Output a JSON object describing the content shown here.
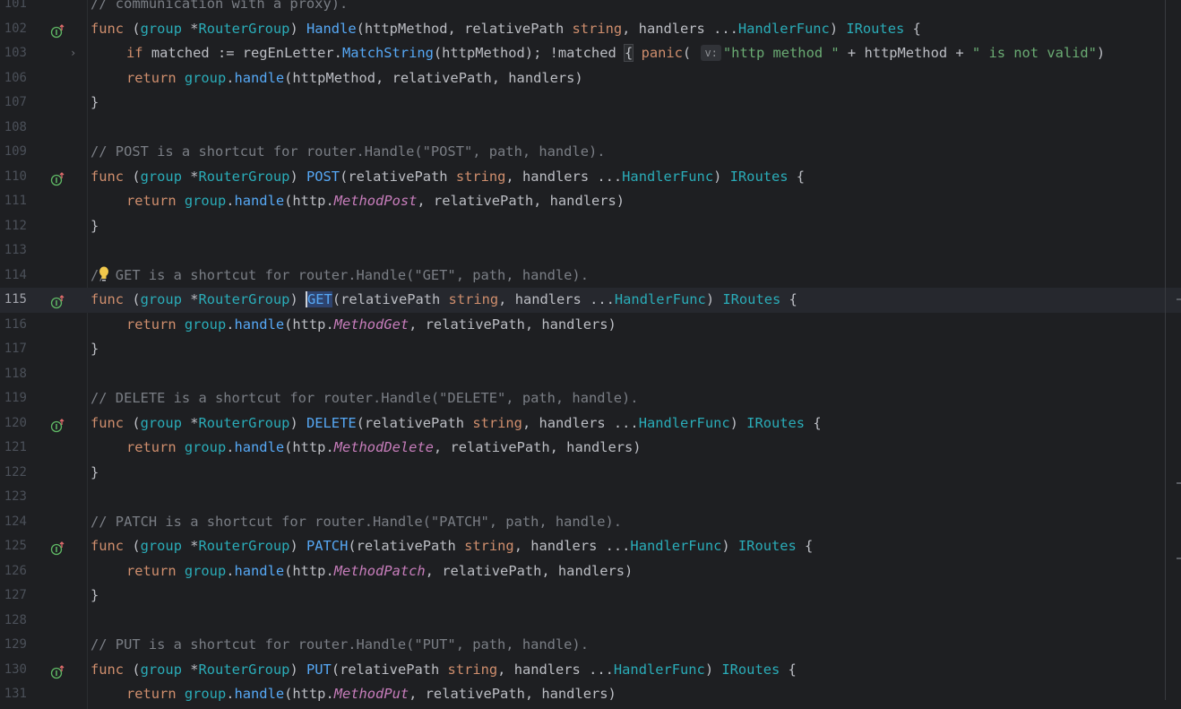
{
  "editor": {
    "lines": [
      {
        "num": "101",
        "top_cut": true,
        "tokens": [
          {
            "c": "c",
            "t": "// communication with a proxy)."
          }
        ]
      },
      {
        "num": "102",
        "impl": true,
        "tokens": [
          {
            "c": "k",
            "t": "func "
          },
          {
            "c": "r",
            "t": "("
          },
          {
            "c": "t",
            "t": "group"
          },
          {
            "c": "r",
            "t": " *"
          },
          {
            "c": "t",
            "t": "RouterGroup"
          },
          {
            "c": "r",
            "t": ") "
          },
          {
            "c": "f",
            "t": "Handle"
          },
          {
            "c": "r",
            "t": "(httpMethod, relativePath "
          },
          {
            "c": "k",
            "t": "string"
          },
          {
            "c": "r",
            "t": ", handlers ..."
          },
          {
            "c": "t",
            "t": "HandlerFunc"
          },
          {
            "c": "r",
            "t": ") "
          },
          {
            "c": "t",
            "t": "IRoutes"
          },
          {
            "c": "r",
            "t": " {"
          }
        ]
      },
      {
        "num": "103",
        "fold": true,
        "indent": true,
        "tokens": [
          {
            "c": "k",
            "t": "if "
          },
          {
            "c": "r",
            "t": "matched := regEnLetter."
          },
          {
            "c": "f",
            "t": "MatchString"
          },
          {
            "c": "r",
            "t": "(httpMethod); !matched "
          },
          {
            "c": "box",
            "t": "{"
          },
          {
            "c": "r",
            "t": " "
          },
          {
            "c": "k",
            "t": "panic"
          },
          {
            "c": "r",
            "t": "( "
          },
          {
            "c": "hint",
            "t": "v:"
          },
          {
            "c": "str",
            "t": "\"http method \""
          },
          {
            "c": "r",
            "t": " + httpMethod + "
          },
          {
            "c": "str",
            "t": "\" is not valid\""
          },
          {
            "c": "r",
            "t": ")"
          }
        ]
      },
      {
        "num": "106",
        "indent": true,
        "tokens": [
          {
            "c": "k",
            "t": "return "
          },
          {
            "c": "t",
            "t": "group"
          },
          {
            "c": "r",
            "t": "."
          },
          {
            "c": "f",
            "t": "handle"
          },
          {
            "c": "r",
            "t": "(httpMethod, relativePath, handlers)"
          }
        ]
      },
      {
        "num": "107",
        "tokens": [
          {
            "c": "r",
            "t": "}"
          }
        ]
      },
      {
        "num": "108",
        "tokens": []
      },
      {
        "num": "109",
        "tokens": [
          {
            "c": "c",
            "t": "// POST is a shortcut for router.Handle(\"POST\", path, handle)."
          }
        ]
      },
      {
        "num": "110",
        "impl": true,
        "tokens": [
          {
            "c": "k",
            "t": "func "
          },
          {
            "c": "r",
            "t": "("
          },
          {
            "c": "t",
            "t": "group"
          },
          {
            "c": "r",
            "t": " *"
          },
          {
            "c": "t",
            "t": "RouterGroup"
          },
          {
            "c": "r",
            "t": ") "
          },
          {
            "c": "f",
            "t": "POST"
          },
          {
            "c": "r",
            "t": "(relativePath "
          },
          {
            "c": "k",
            "t": "string"
          },
          {
            "c": "r",
            "t": ", handlers ..."
          },
          {
            "c": "t",
            "t": "HandlerFunc"
          },
          {
            "c": "r",
            "t": ") "
          },
          {
            "c": "t",
            "t": "IRoutes"
          },
          {
            "c": "r",
            "t": " {"
          }
        ]
      },
      {
        "num": "111",
        "indent": true,
        "tokens": [
          {
            "c": "k",
            "t": "return "
          },
          {
            "c": "t",
            "t": "group"
          },
          {
            "c": "r",
            "t": "."
          },
          {
            "c": "f",
            "t": "handle"
          },
          {
            "c": "r",
            "t": "(http."
          },
          {
            "c": "m",
            "t": "MethodPost"
          },
          {
            "c": "r",
            "t": ", relativePath, handlers)"
          }
        ]
      },
      {
        "num": "112",
        "tokens": [
          {
            "c": "r",
            "t": "}"
          }
        ]
      },
      {
        "num": "113",
        "tokens": []
      },
      {
        "num": "114",
        "bulb": true,
        "tokens": [
          {
            "c": "c",
            "t": "// GET is a shortcut for router.Handle(\"GET\", path, handle)."
          }
        ]
      },
      {
        "num": "115",
        "impl": true,
        "current": true,
        "tokens": [
          {
            "c": "k",
            "t": "func "
          },
          {
            "c": "r",
            "t": "("
          },
          {
            "c": "t",
            "t": "group"
          },
          {
            "c": "r",
            "t": " *"
          },
          {
            "c": "t",
            "t": "RouterGroup"
          },
          {
            "c": "r",
            "t": ") "
          },
          {
            "c": "caretsel",
            "t": "GET"
          },
          {
            "c": "r",
            "t": "(relativePath "
          },
          {
            "c": "k",
            "t": "string"
          },
          {
            "c": "r",
            "t": ", handlers ..."
          },
          {
            "c": "t",
            "t": "HandlerFunc"
          },
          {
            "c": "r",
            "t": ") "
          },
          {
            "c": "t",
            "t": "IRoutes"
          },
          {
            "c": "r",
            "t": " {"
          }
        ]
      },
      {
        "num": "116",
        "indent": true,
        "tokens": [
          {
            "c": "k",
            "t": "return "
          },
          {
            "c": "t",
            "t": "group"
          },
          {
            "c": "r",
            "t": "."
          },
          {
            "c": "f",
            "t": "handle"
          },
          {
            "c": "r",
            "t": "(http."
          },
          {
            "c": "m",
            "t": "MethodGet"
          },
          {
            "c": "r",
            "t": ", relativePath, handlers)"
          }
        ]
      },
      {
        "num": "117",
        "tokens": [
          {
            "c": "r",
            "t": "}"
          }
        ]
      },
      {
        "num": "118",
        "tokens": []
      },
      {
        "num": "119",
        "tokens": [
          {
            "c": "c",
            "t": "// DELETE is a shortcut for router.Handle(\"DELETE\", path, handle)."
          }
        ]
      },
      {
        "num": "120",
        "impl": true,
        "tokens": [
          {
            "c": "k",
            "t": "func "
          },
          {
            "c": "r",
            "t": "("
          },
          {
            "c": "t",
            "t": "group"
          },
          {
            "c": "r",
            "t": " *"
          },
          {
            "c": "t",
            "t": "RouterGroup"
          },
          {
            "c": "r",
            "t": ") "
          },
          {
            "c": "f",
            "t": "DELETE"
          },
          {
            "c": "r",
            "t": "(relativePath "
          },
          {
            "c": "k",
            "t": "string"
          },
          {
            "c": "r",
            "t": ", handlers ..."
          },
          {
            "c": "t",
            "t": "HandlerFunc"
          },
          {
            "c": "r",
            "t": ") "
          },
          {
            "c": "t",
            "t": "IRoutes"
          },
          {
            "c": "r",
            "t": " {"
          }
        ]
      },
      {
        "num": "121",
        "indent": true,
        "tokens": [
          {
            "c": "k",
            "t": "return "
          },
          {
            "c": "t",
            "t": "group"
          },
          {
            "c": "r",
            "t": "."
          },
          {
            "c": "f",
            "t": "handle"
          },
          {
            "c": "r",
            "t": "(http."
          },
          {
            "c": "m",
            "t": "MethodDelete"
          },
          {
            "c": "r",
            "t": ", relativePath, handlers)"
          }
        ]
      },
      {
        "num": "122",
        "tokens": [
          {
            "c": "r",
            "t": "}"
          }
        ]
      },
      {
        "num": "123",
        "tokens": []
      },
      {
        "num": "124",
        "tokens": [
          {
            "c": "c",
            "t": "// PATCH is a shortcut for router.Handle(\"PATCH\", path, handle)."
          }
        ]
      },
      {
        "num": "125",
        "impl": true,
        "tokens": [
          {
            "c": "k",
            "t": "func "
          },
          {
            "c": "r",
            "t": "("
          },
          {
            "c": "t",
            "t": "group"
          },
          {
            "c": "r",
            "t": " *"
          },
          {
            "c": "t",
            "t": "RouterGroup"
          },
          {
            "c": "r",
            "t": ") "
          },
          {
            "c": "f",
            "t": "PATCH"
          },
          {
            "c": "r",
            "t": "(relativePath "
          },
          {
            "c": "k",
            "t": "string"
          },
          {
            "c": "r",
            "t": ", handlers ..."
          },
          {
            "c": "t",
            "t": "HandlerFunc"
          },
          {
            "c": "r",
            "t": ") "
          },
          {
            "c": "t",
            "t": "IRoutes"
          },
          {
            "c": "r",
            "t": " {"
          }
        ]
      },
      {
        "num": "126",
        "indent": true,
        "tokens": [
          {
            "c": "k",
            "t": "return "
          },
          {
            "c": "t",
            "t": "group"
          },
          {
            "c": "r",
            "t": "."
          },
          {
            "c": "f",
            "t": "handle"
          },
          {
            "c": "r",
            "t": "(http."
          },
          {
            "c": "m",
            "t": "MethodPatch"
          },
          {
            "c": "r",
            "t": ", relativePath, handlers)"
          }
        ]
      },
      {
        "num": "127",
        "tokens": [
          {
            "c": "r",
            "t": "}"
          }
        ]
      },
      {
        "num": "128",
        "tokens": []
      },
      {
        "num": "129",
        "tokens": [
          {
            "c": "c",
            "t": "// PUT is a shortcut for router.Handle(\"PUT\", path, handle)."
          }
        ]
      },
      {
        "num": "130",
        "impl": true,
        "tokens": [
          {
            "c": "k",
            "t": "func "
          },
          {
            "c": "r",
            "t": "("
          },
          {
            "c": "t",
            "t": "group"
          },
          {
            "c": "r",
            "t": " *"
          },
          {
            "c": "t",
            "t": "RouterGroup"
          },
          {
            "c": "r",
            "t": ") "
          },
          {
            "c": "f",
            "t": "PUT"
          },
          {
            "c": "r",
            "t": "(relativePath "
          },
          {
            "c": "k",
            "t": "string"
          },
          {
            "c": "r",
            "t": ", handlers ..."
          },
          {
            "c": "t",
            "t": "HandlerFunc"
          },
          {
            "c": "r",
            "t": ") "
          },
          {
            "c": "t",
            "t": "IRoutes"
          },
          {
            "c": "r",
            "t": " {"
          }
        ]
      },
      {
        "num": "131",
        "indent": true,
        "tokens": [
          {
            "c": "k",
            "t": "return "
          },
          {
            "c": "t",
            "t": "group"
          },
          {
            "c": "r",
            "t": "."
          },
          {
            "c": "f",
            "t": "handle"
          },
          {
            "c": "r",
            "t": "(http."
          },
          {
            "c": "m",
            "t": "MethodPut"
          },
          {
            "c": "r",
            "t": ", relativePath, handlers)"
          }
        ]
      }
    ],
    "gutter_icon": "implements-interface-icon",
    "fold_icon": "chevron-right-icon",
    "bulb_icon": "lightbulb-icon"
  }
}
